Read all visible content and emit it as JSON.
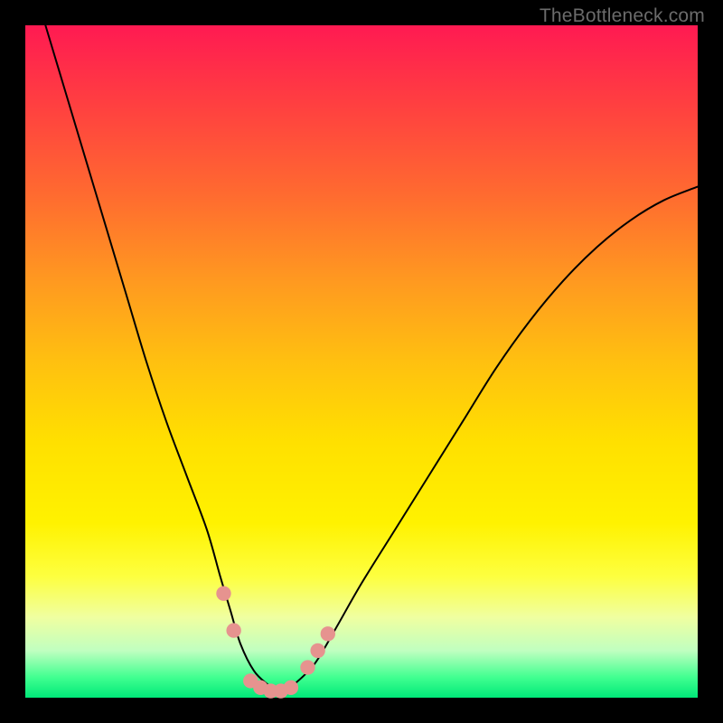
{
  "watermark": "TheBottleneck.com",
  "chart_data": {
    "type": "line",
    "title": "",
    "xlabel": "",
    "ylabel": "",
    "xlim": [
      0,
      100
    ],
    "ylim": [
      0,
      100
    ],
    "series": [
      {
        "name": "curve",
        "x": [
          3,
          6,
          9,
          12,
          15,
          18,
          21,
          24,
          27,
          29,
          30.5,
          32,
          34,
          36,
          37.5,
          38.5,
          40,
          43,
          46,
          50,
          55,
          60,
          65,
          70,
          75,
          80,
          85,
          90,
          95,
          100
        ],
        "y": [
          100,
          90,
          80,
          70,
          60,
          50,
          41,
          33,
          25,
          18,
          13,
          8,
          4,
          2,
          1,
          1,
          2,
          5,
          10,
          17,
          25,
          33,
          41,
          49,
          56,
          62,
          67,
          71,
          74,
          76
        ]
      }
    ],
    "markers": [
      {
        "x": 29.5,
        "y": 15.5,
        "r": 1.1
      },
      {
        "x": 31.0,
        "y": 10.0,
        "r": 1.1
      },
      {
        "x": 33.5,
        "y": 2.5,
        "r": 1.1
      },
      {
        "x": 35.0,
        "y": 1.5,
        "r": 1.1
      },
      {
        "x": 36.5,
        "y": 1.0,
        "r": 1.1
      },
      {
        "x": 38.0,
        "y": 1.0,
        "r": 1.1
      },
      {
        "x": 39.5,
        "y": 1.5,
        "r": 1.1
      },
      {
        "x": 42.0,
        "y": 4.5,
        "r": 1.1
      },
      {
        "x": 43.5,
        "y": 7.0,
        "r": 1.1
      },
      {
        "x": 45.0,
        "y": 9.5,
        "r": 1.1
      }
    ],
    "gradient_stops": [
      {
        "pct": 0,
        "color": "#ff1a52"
      },
      {
        "pct": 50,
        "color": "#ffe000"
      },
      {
        "pct": 100,
        "color": "#00e878"
      }
    ],
    "marker_color": "#e6938f"
  }
}
